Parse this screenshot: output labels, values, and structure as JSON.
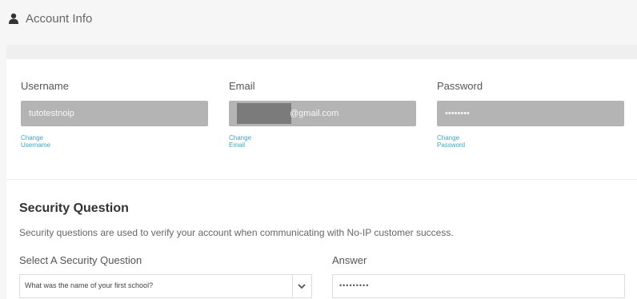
{
  "header": {
    "title": "Account Info",
    "icon": "user-icon"
  },
  "account": {
    "username": {
      "label": "Username",
      "value": "tutotestnoip",
      "link": "Change Username"
    },
    "email": {
      "label": "Email",
      "value_suffix": "@gmail.com",
      "link": "Change Email"
    },
    "password": {
      "label": "Password",
      "value": "••••••••",
      "link": "Change Password"
    }
  },
  "security": {
    "title": "Security Question",
    "description": "Security questions are used to verify your account when communicating with No-IP customer success.",
    "select_label": "Select A Security Question",
    "select_value": "What was the name of your first school?",
    "answer_label": "Answer",
    "answer_value": "•••••••••"
  },
  "colors": {
    "link": "#3ba7c6",
    "field_bg": "#b4b4b4"
  }
}
